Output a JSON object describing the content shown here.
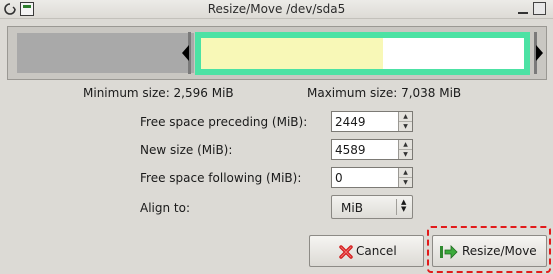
{
  "window": {
    "title": "Resize/Move /dev/sda5"
  },
  "partition_visual": {
    "colors": {
      "unallocated": "#a9a9a9",
      "partition_border": "#4ce2a4",
      "used": "#f8f8b7",
      "unused": "#ffffff"
    }
  },
  "info": {
    "minimum": "Minimum size: 2,596 MiB",
    "maximum": "Maximum size: 7,038 MiB"
  },
  "form": {
    "free_preceding_label": "Free space preceding (MiB):",
    "free_preceding_value": "2449",
    "new_size_label": "New size (MiB):",
    "new_size_value": "4589",
    "free_following_label": "Free space following (MiB):",
    "free_following_value": "0",
    "align_label": "Align to:",
    "align_value": "MiB"
  },
  "buttons": {
    "cancel": "Cancel",
    "resize_move": "Resize/Move"
  },
  "highlight": {
    "color": "#e21a1a"
  }
}
